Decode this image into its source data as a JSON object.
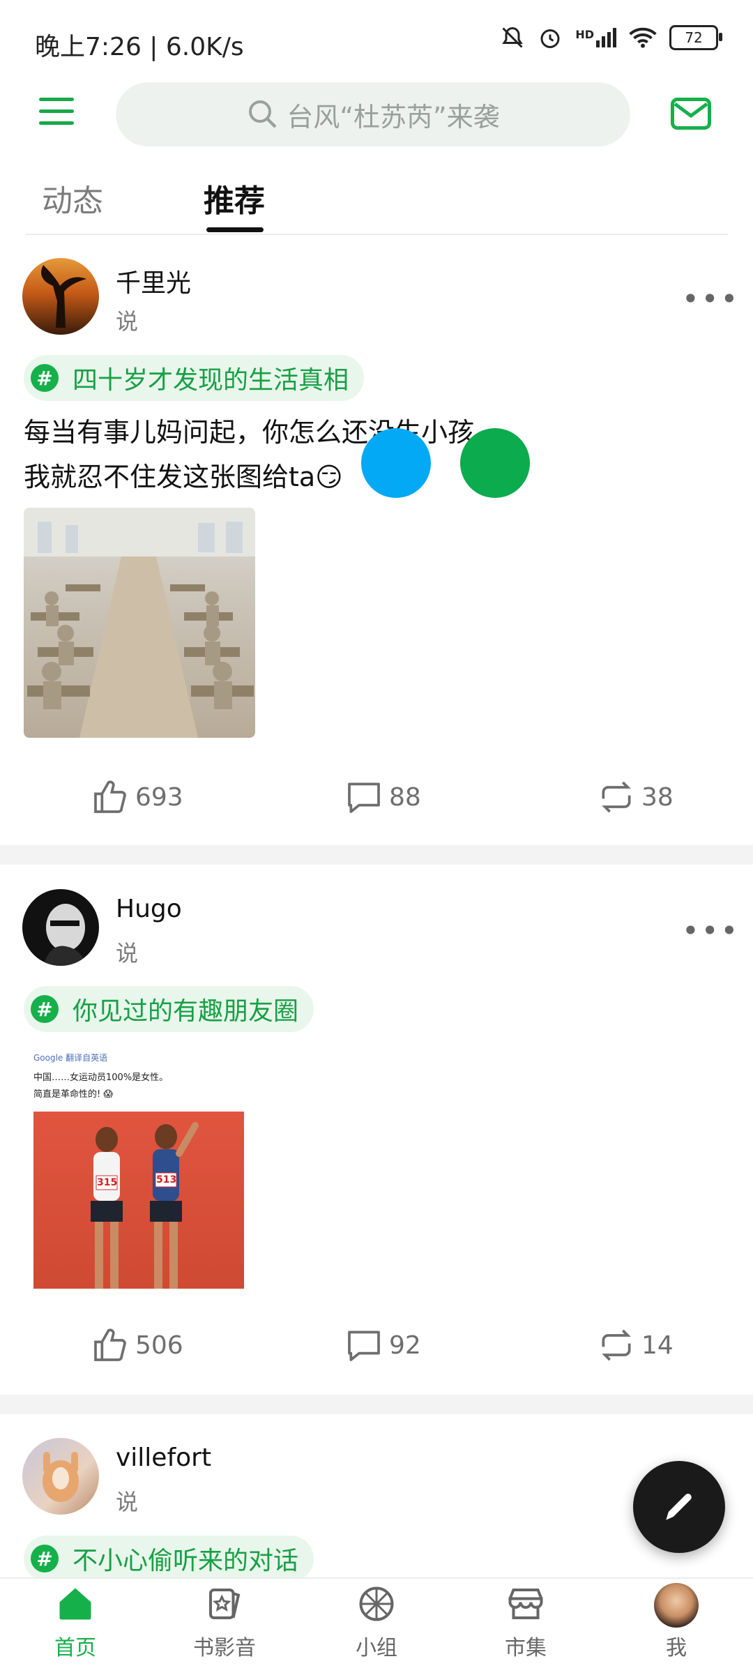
{
  "status_bar": {
    "time": "晚上7:26 | 6.0K/s",
    "network_label": "HD",
    "battery": "72"
  },
  "header": {
    "search_placeholder": "台风“杜苏芮”来袭"
  },
  "tabs": [
    {
      "label": "动态"
    },
    {
      "label": "推荐"
    }
  ],
  "posts": [
    {
      "username": "千里光",
      "verb": "说",
      "topic": "四十岁才发现的生活真相",
      "text_line1": "每当有事儿妈问起，你怎么还没生小孩",
      "text_line2": "我就忍不住发这张图给ta😏",
      "likes": "693",
      "comments": "88",
      "reposts": "38"
    },
    {
      "username": "Hugo",
      "verb": "说",
      "topic": "你见过的有趣朋友圈",
      "image_caption_line1": "中国……女运动员100%是女性。",
      "image_caption_line2": "简直是革命性的! 😱",
      "image_header": "Google 翻译自英语",
      "bib_left": "315",
      "bib_right": "513",
      "likes": "506",
      "comments": "92",
      "reposts": "14"
    },
    {
      "username": "villefort",
      "verb": "说",
      "topic": "不小心偷听来的对话"
    }
  ],
  "bottom_nav": [
    {
      "label": "首页"
    },
    {
      "label": "书影音"
    },
    {
      "label": "小组"
    },
    {
      "label": "市集"
    },
    {
      "label": "我"
    }
  ],
  "colors": {
    "accent": "#15b04a",
    "blue_dot": "#03a9f4",
    "green_dot": "#0bab4e"
  }
}
